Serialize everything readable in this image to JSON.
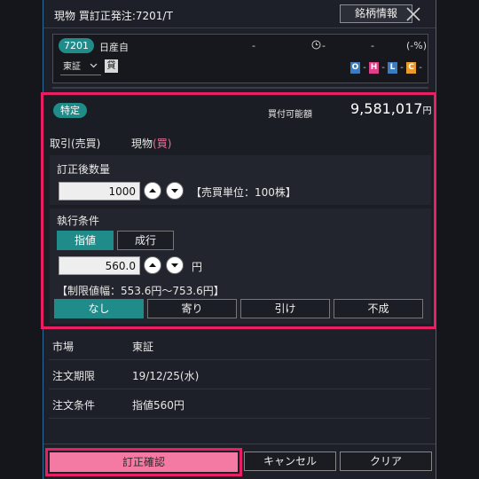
{
  "header": {
    "title": "現物 買訂正発注:7201/T",
    "info_button": "銘柄情報"
  },
  "stock": {
    "code": "7201",
    "name": "日産自",
    "price": "-",
    "change": "-",
    "time": "-",
    "change_pct": "(-%)",
    "market": "東証",
    "loan_badge": "貸",
    "ohlc_labels": [
      "O",
      "H",
      "L",
      "C"
    ],
    "ohlc_values": [
      "-",
      "-",
      "-",
      "-"
    ],
    "ohlc_colors": [
      "#3b7bbf",
      "#e0408a",
      "#3b7bbf",
      "#e89a2a"
    ]
  },
  "form": {
    "account_badge": "特定",
    "buying_power_label": "買付可能額",
    "buying_power_value": "9,581,017",
    "buying_power_unit": "円",
    "trade_label": "取引(売買)",
    "trade_value_main": "現物",
    "trade_value_side": "(買)",
    "qty_label": "訂正後数量",
    "qty_value": "1000",
    "qty_unit_note": "【売買単位：100株】",
    "exec_label": "執行条件",
    "exec_tabs": [
      "指値",
      "成行"
    ],
    "exec_selected": "指値",
    "price_value": "560.0",
    "price_unit": "円",
    "limit_range": "【制限値幅：553.6円～753.6円】",
    "cond_tabs": [
      "なし",
      "寄り",
      "引け",
      "不成"
    ],
    "cond_selected": "なし"
  },
  "info": {
    "market_label": "市場",
    "market_value": "東証",
    "period_label": "注文期限",
    "period_value": "19/12/25(水)",
    "cond_label": "注文条件",
    "cond_value": "指値560円"
  },
  "footer": {
    "confirm": "訂正確認",
    "cancel": "キャンセル",
    "clear": "クリア"
  },
  "colors": {
    "accent_teal": "#1f8c8a",
    "highlight_pink": "#ea1f63",
    "confirm_pink": "#f47aa4"
  }
}
